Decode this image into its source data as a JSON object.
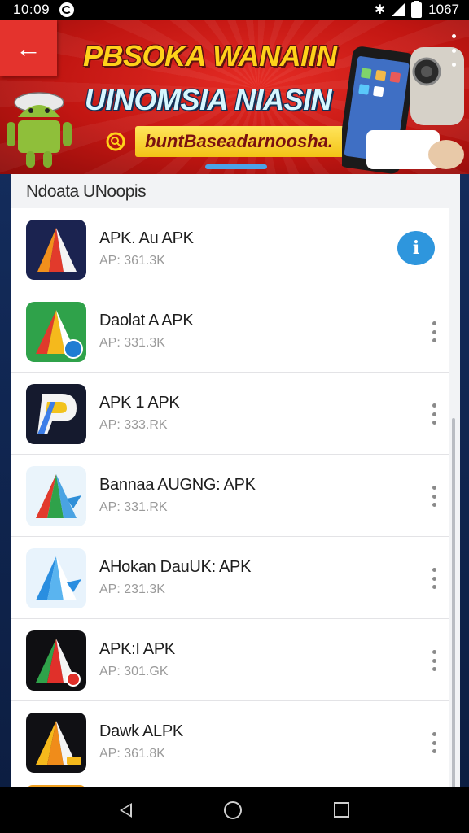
{
  "status_bar": {
    "time": "10:09",
    "battery": "1067",
    "icons": [
      "notification-icon",
      "bluetooth-icon",
      "signal-icon",
      "battery-icon"
    ]
  },
  "banner": {
    "title": "PBSOKA WANAIIN",
    "subtitle": "UINOMSIA NIASIN",
    "pill_text": "buntBaseadarnoosha.",
    "colors": {
      "background": "#c21612",
      "title": "#ffd21a",
      "subtitle": "#d6f6ff",
      "pill": "#f3c316",
      "indicator": "#4ba3e8"
    }
  },
  "section": {
    "title": "Ndoata UNoopis"
  },
  "apps": [
    {
      "name": "APK. Au APK",
      "size": "AP: 361.3K",
      "action": "info",
      "action_label": "i"
    },
    {
      "name": "Daolat A APK",
      "size": "AP: 331.3K",
      "action": "more"
    },
    {
      "name": "APK 1 APK",
      "size": "AP: 333.RK",
      "action": "more"
    },
    {
      "name": "Bannaa AUGNG: APK",
      "size": "AP: 331.RK",
      "action": "more"
    },
    {
      "name": "AHokan DauUK: APK",
      "size": "AP: 231.3K",
      "action": "more"
    },
    {
      "name": "APK:I APK",
      "size": "AP: 301.GK",
      "action": "more"
    },
    {
      "name": "Dawk ALPK",
      "size": "AP: 361.8K",
      "action": "more"
    }
  ],
  "nav_bar": {
    "buttons": [
      "back-icon",
      "home-icon",
      "recents-icon"
    ]
  }
}
